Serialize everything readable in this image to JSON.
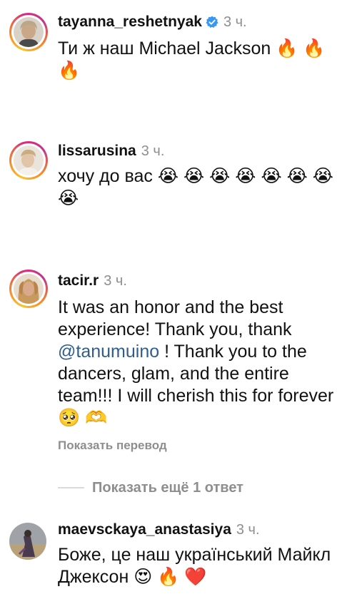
{
  "comments": [
    {
      "username": "tayanna_reshetnyak",
      "verified": true,
      "time": "3 ч.",
      "text": "Ти ж наш Michael Jackson 🔥 🔥 🔥"
    },
    {
      "username": "lissarusina",
      "time": "3 ч.",
      "text": "хочу до вас 😭 😭 😭 😭 😭 😭 😭 😭"
    },
    {
      "username": "tacir.r",
      "time": "3 ч.",
      "text_before": "It was an honor and the best experience! Thank you, thank ",
      "mention": "@tanumuino",
      "text_after": " ! Thank you to the dancers, glam, and the entire team!!! I will cherish this for forever 🥺 🫶",
      "translate_label": "Показать перевод"
    },
    {
      "username": "maevsckaya_anastasiya",
      "time": "3 ч.",
      "text": "Боже, це наш український Майкл Джексон 😍 🔥 ❤️"
    }
  ],
  "more_replies_label": "Показать ещё 1 ответ",
  "icons": {
    "verified": "verified-badge-icon"
  },
  "colors": {
    "verified_blue": "#3897f0",
    "mention": "#2f5d8c",
    "secondary_text": "#8e8e8e"
  }
}
